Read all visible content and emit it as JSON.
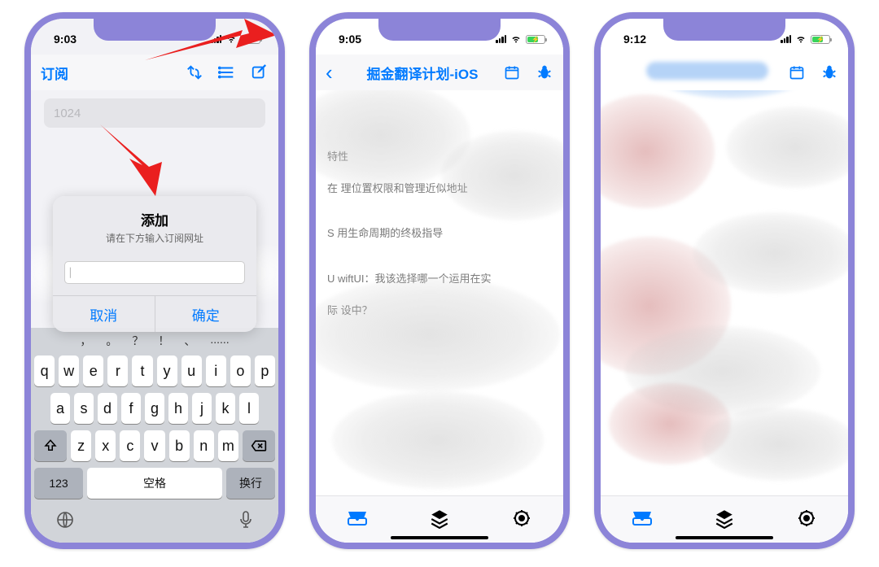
{
  "phone1": {
    "time": "9:03",
    "nav_title": "订阅",
    "search_placeholder": "1024",
    "alert": {
      "title": "添加",
      "subtitle": "请在下方输入订阅网址",
      "input_hint": "",
      "cancel": "取消",
      "confirm": "确定"
    },
    "keyboard": {
      "sym_row": [
        "，",
        "。",
        "？",
        "！",
        "、",
        "......"
      ],
      "row1": [
        "q",
        "w",
        "e",
        "r",
        "t",
        "y",
        "u",
        "i",
        "o",
        "p"
      ],
      "row2": [
        "a",
        "s",
        "d",
        "f",
        "g",
        "h",
        "j",
        "k",
        "l"
      ],
      "row3": [
        "z",
        "x",
        "c",
        "v",
        "b",
        "n",
        "m"
      ],
      "num_key": "123",
      "space": "空格",
      "return": "换行"
    }
  },
  "phone2": {
    "time": "9:05",
    "nav_title": "掘金翻译计划-iOS",
    "lines": [
      "特性",
      "在           理位置权限和管理近似地址",
      "S            用生命周期的终极指导",
      "U      wiftUI：我该选择哪一个运用在实",
      "际           设中？"
    ]
  },
  "phone3": {
    "time": "9:12"
  },
  "icons": {
    "refresh": "refresh-icon",
    "list": "list-icon",
    "compose": "compose-icon",
    "calendar": "calendar-icon",
    "bug": "bug-icon",
    "back": "back-icon",
    "tray": "tray-icon",
    "layers": "layers-icon",
    "gear": "gear-icon",
    "globe": "globe-icon",
    "mic": "mic-icon",
    "shift": "shift-icon",
    "backspace": "backspace-icon"
  }
}
